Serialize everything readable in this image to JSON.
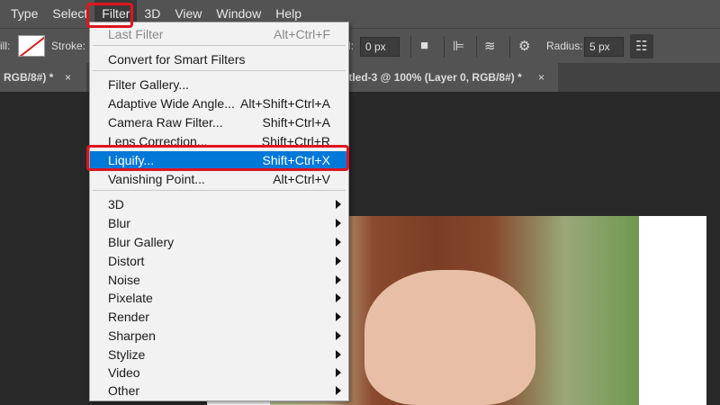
{
  "menubar": {
    "items": [
      "Type",
      "Select",
      "Filter",
      "3D",
      "View",
      "Window",
      "Help"
    ]
  },
  "options": {
    "fill_label": "ill:",
    "stroke_label": "Stroke:",
    "field_label": "l:",
    "width_value": "0 px",
    "radius_label": "Radius:",
    "radius_value": "5 px"
  },
  "tabs": [
    {
      "label": "RGB/8#) *",
      "close": "×"
    },
    {
      "label": "itled-3 @ 100% (Layer 0, RGB/8#) *",
      "close": "×"
    }
  ],
  "filter_menu": {
    "items": [
      {
        "label": "Last Filter",
        "shortcut": "Alt+Ctrl+F",
        "disabled": true
      },
      {
        "label": "Convert for Smart Filters",
        "shortcut": ""
      },
      {
        "label": "Filter Gallery...",
        "shortcut": ""
      },
      {
        "label": "Adaptive Wide Angle...",
        "shortcut": "Alt+Shift+Ctrl+A"
      },
      {
        "label": "Camera Raw Filter...",
        "shortcut": "Shift+Ctrl+A"
      },
      {
        "label": "Lens Correction...",
        "shortcut": "Shift+Ctrl+R"
      },
      {
        "label": "Liquify...",
        "shortcut": "Shift+Ctrl+X",
        "highlighted": true
      },
      {
        "label": "Vanishing Point...",
        "shortcut": "Alt+Ctrl+V"
      },
      {
        "label": "3D",
        "submenu": true
      },
      {
        "label": "Blur",
        "submenu": true
      },
      {
        "label": "Blur Gallery",
        "submenu": true
      },
      {
        "label": "Distort",
        "submenu": true
      },
      {
        "label": "Noise",
        "submenu": true
      },
      {
        "label": "Pixelate",
        "submenu": true
      },
      {
        "label": "Render",
        "submenu": true
      },
      {
        "label": "Sharpen",
        "submenu": true
      },
      {
        "label": "Stylize",
        "submenu": true
      },
      {
        "label": "Video",
        "submenu": true
      },
      {
        "label": "Other",
        "submenu": true
      }
    ]
  },
  "colors": {
    "highlight": "#0078d7",
    "annotation": "#e0141e"
  }
}
